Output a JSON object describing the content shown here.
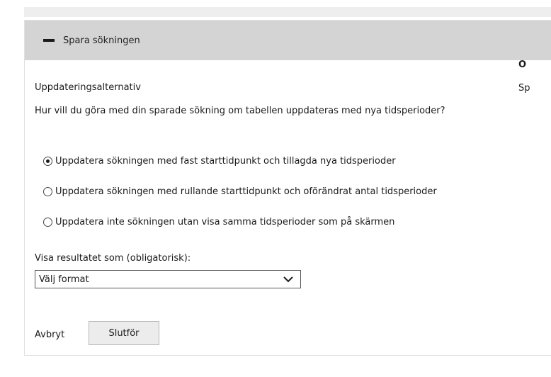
{
  "panel": {
    "header_label": "Spara sökningen"
  },
  "update": {
    "title": "Uppdateringsalternativ",
    "question": "Hur vill du göra med din sparade sökning om tabellen uppdateras med nya tidsperioder?",
    "options": [
      {
        "label": "Uppdatera sökningen med fast starttidpunkt och tillagda nya tidsperioder",
        "checked": true
      },
      {
        "label": "Uppdatera sökningen med rullande starttidpunkt och oförändrat antal tidsperioder",
        "checked": false
      },
      {
        "label": "Uppdatera inte sökningen utan visa samma tidsperioder som på skärmen",
        "checked": false
      }
    ]
  },
  "format": {
    "label": "Visa resultatet som (obligatorisk):",
    "selected": "Välj format"
  },
  "actions": {
    "cancel_label": "Avbryt",
    "finish_label": "Slutför"
  },
  "side": {
    "heading": "O",
    "text": "Sp"
  }
}
